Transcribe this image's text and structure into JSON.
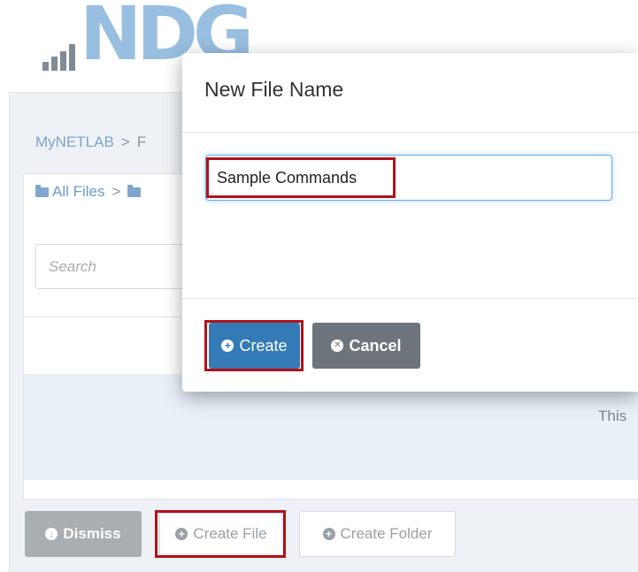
{
  "logo": {
    "text": "NDG"
  },
  "breadcrumb": {
    "root": "MyNETLAB",
    "separator": ">",
    "next": "F"
  },
  "files": {
    "all_files": "All Files",
    "separator": ">"
  },
  "search": {
    "placeholder": "Search"
  },
  "table": {
    "empty_text": "This"
  },
  "bottom_actions": {
    "dismiss": "Dismiss",
    "create_file": "Create File",
    "create_folder": "Create Folder"
  },
  "modal": {
    "title": "New File Name",
    "input_value": "Sample Commands",
    "create_label": "Create",
    "cancel_label": "Cancel"
  },
  "icons": {
    "plus": "plus-circle-icon",
    "times": "times-circle-icon",
    "download": "arrow-down-circle-icon",
    "folder": "folder-icon"
  },
  "colors": {
    "primary": "#337ab7",
    "cancel": "#6d747b",
    "highlight": "#b01219",
    "logo": "#98bfe0"
  }
}
